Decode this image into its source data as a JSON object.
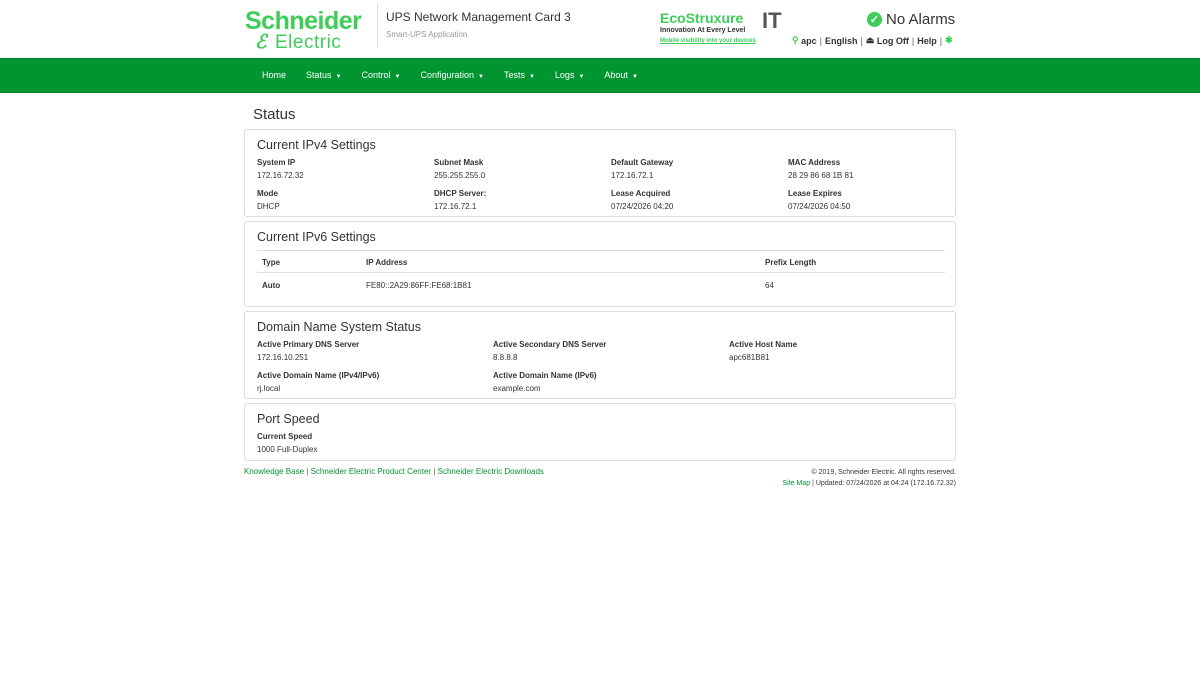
{
  "header": {
    "brand_line1": "Schneider",
    "brand_line2": "Electric",
    "app_title": "UPS Network Management Card 3",
    "app_subtitle": "Smart-UPS Application",
    "eco_title": "EcoStruxure",
    "eco_it": "IT",
    "eco_tagline": "Innovation At Every Level",
    "eco_link": "Mobile visibility into your devices",
    "alarm_status": "No Alarms",
    "user": "apc",
    "language": "English",
    "logoff": "Log Off",
    "help": "Help"
  },
  "nav": [
    "Home",
    "Status",
    "Control",
    "Configuration",
    "Tests",
    "Logs",
    "About"
  ],
  "nav_dropdown": [
    false,
    true,
    true,
    true,
    true,
    true,
    true
  ],
  "page_title": "Status",
  "ipv4": {
    "title": "Current IPv4 Settings",
    "fields": [
      {
        "label": "System IP",
        "value": "172.16.72.32"
      },
      {
        "label": "Subnet Mask",
        "value": "255.255.255.0"
      },
      {
        "label": "Default Gateway",
        "value": "172.16.72.1"
      },
      {
        "label": "MAC Address",
        "value": "28 29 86 68 1B 81"
      },
      {
        "label": "Mode",
        "value": "DHCP"
      },
      {
        "label": "DHCP Server:",
        "value": "172.16.72.1"
      },
      {
        "label": "Lease Acquired",
        "value": "07/24/2026 04:20"
      },
      {
        "label": "Lease Expires",
        "value": "07/24/2026 04:50"
      }
    ]
  },
  "ipv6": {
    "title": "Current IPv6 Settings",
    "columns": [
      "Type",
      "IP Address",
      "Prefix Length"
    ],
    "rows": [
      [
        "Auto",
        "FE80::2A29:86FF:FE68:1B81",
        "64"
      ]
    ]
  },
  "dns": {
    "title": "Domain Name System Status",
    "fields": [
      {
        "label": "Active Primary DNS Server",
        "value": "172.16.10.251"
      },
      {
        "label": "Active Secondary DNS Server",
        "value": "8.8.8.8"
      },
      {
        "label": "Active Host Name",
        "value": "apc681B81"
      },
      {
        "label": "Active Domain Name (IPv4/IPv6)",
        "value": "rj.local"
      },
      {
        "label": "Active Domain Name (IPv6)",
        "value": "example.com"
      }
    ]
  },
  "port": {
    "title": "Port Speed",
    "label": "Current Speed",
    "value": "1000 Full-Duplex"
  },
  "footer": {
    "links": [
      "Knowledge Base",
      "Schneider Electric Product Center",
      "Schneider Electric Downloads"
    ],
    "copyright": "© 2019, Schneider Electric. All rights reserved.",
    "sitemap": "Site Map",
    "updated": "Updated: 07/24/2026 at 04:24 (172.16.72.32)"
  },
  "colors": {
    "brand_green": "#3dcd58",
    "nav_green": "#009530"
  }
}
